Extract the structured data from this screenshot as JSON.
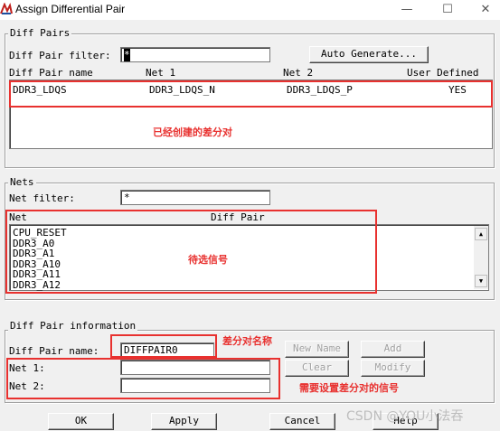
{
  "window": {
    "title": "Assign Differential Pair",
    "minimize_glyph": "—",
    "maximize_glyph": "☐",
    "close_glyph": "✕"
  },
  "diff_pairs": {
    "group_title": "Diff Pairs",
    "filter_label": "Diff Pair filter:",
    "filter_value": "*",
    "auto_generate_label": "Auto Generate...",
    "columns": [
      "Diff Pair name",
      "Net 1",
      "Net 2",
      "User Defined"
    ],
    "rows": [
      {
        "name": "DDR3_LDQS",
        "net1": "DDR3_LDQS_N",
        "net2": "DDR3_LDQS_P",
        "user_defined": "YES"
      }
    ],
    "annotation": "已经创建的差分对"
  },
  "nets": {
    "group_title": "Nets",
    "filter_label": "Net filter:",
    "filter_value": "*",
    "columns": [
      "Net",
      "Diff Pair"
    ],
    "items": [
      "CPU_RESET",
      "DDR3_A0",
      "DDR3_A1",
      "DDR3_A10",
      "DDR3_A11",
      "DDR3_A12"
    ],
    "annotation": "待选信号"
  },
  "info": {
    "group_title": "Diff Pair information",
    "name_label": "Diff Pair name:",
    "name_value": "DIFFPAIR0",
    "net1_label": "Net 1:",
    "net1_value": "",
    "net2_label": "Net 2:",
    "net2_value": "",
    "new_name_label": "New Name",
    "add_label": "Add",
    "clear_label": "Clear",
    "modify_label": "Modify",
    "name_annotation": "差分对名称",
    "nets_annotation": "需要设置差分对的信号"
  },
  "footer": {
    "ok_label": "OK",
    "apply_label": "Apply",
    "cancel_label": "Cancel",
    "help_label": "Help",
    "watermark": "CSDN @YOU小法吞"
  },
  "colors": {
    "annotation_red": "#e8312f",
    "dialog_bg": "#f0f0f0"
  }
}
